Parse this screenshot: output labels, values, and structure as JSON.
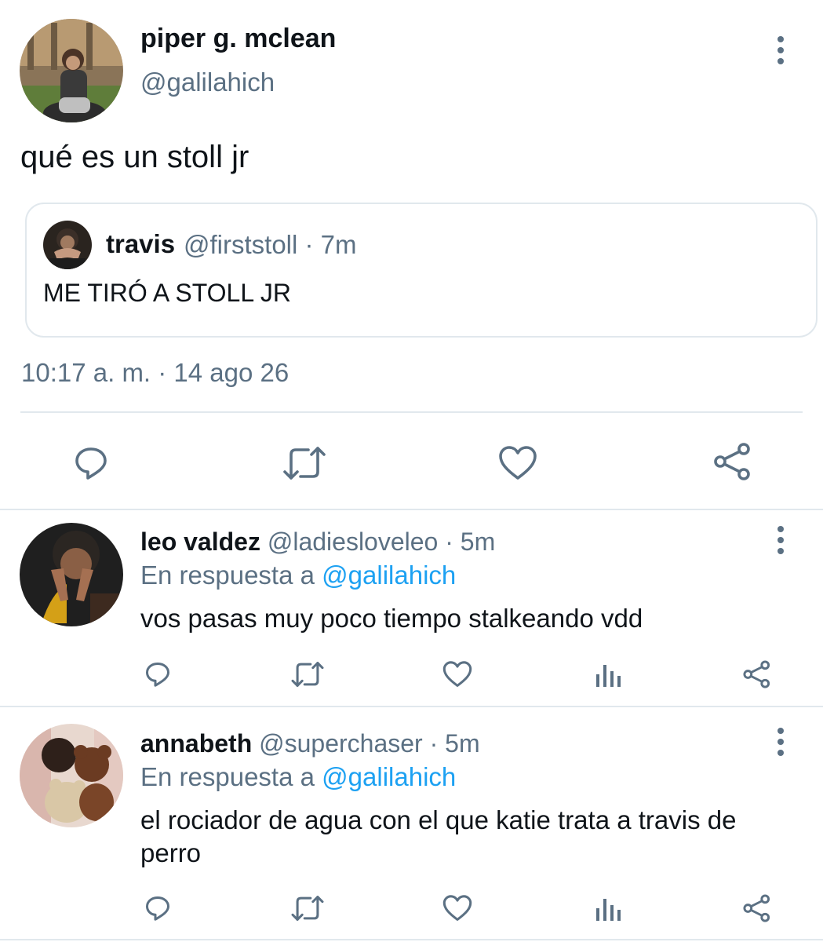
{
  "main_tweet": {
    "display_name": "piper g. mclean",
    "handle": "@galilahich",
    "text": "qué es un stoll jr",
    "timestamp": "10:17 a. m. · 14 ago 26",
    "quoted": {
      "display_name": "travis",
      "handle": "@firststoll · 7m",
      "text": "ME TIRÓ A STOLL JR"
    },
    "actions": [
      "reply-icon",
      "retweet-icon",
      "like-icon",
      "share-icon"
    ]
  },
  "replies": [
    {
      "display_name": "leo valdez",
      "handle": "@ladiesloveleo · 5m",
      "reply_prefix": "En respuesta a",
      "mention": "@galilahich",
      "text": "vos pasas muy poco tiempo stalkeando vdd"
    },
    {
      "display_name": "annabeth",
      "handle": "@superchaser · 5m",
      "reply_prefix": "En respuesta a",
      "mention": "@galilahich",
      "text": "el rociador de agua con el que katie trata a travis de perro"
    }
  ],
  "colors": {
    "text": "#0f1419",
    "secondary": "#5b7083",
    "link": "#1da1f2",
    "divider": "#e1e8ed"
  }
}
